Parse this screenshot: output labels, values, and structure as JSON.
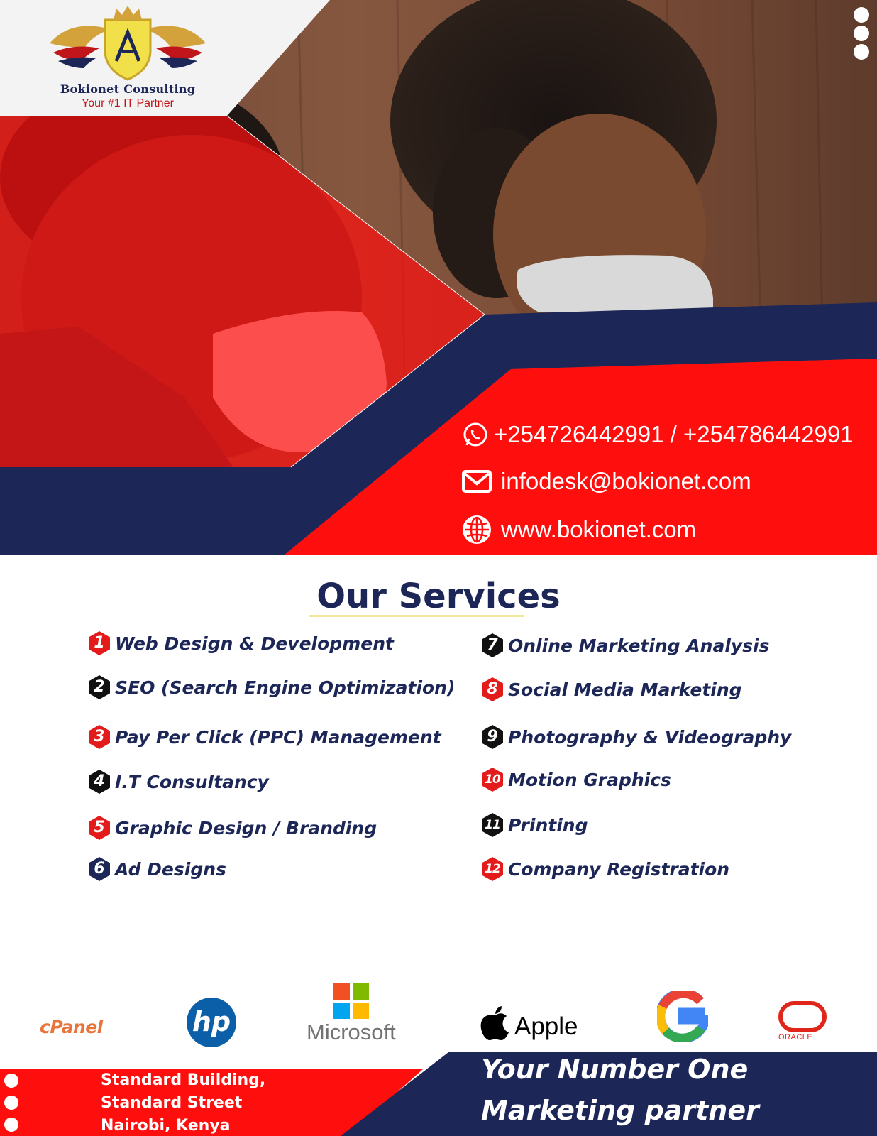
{
  "brand": {
    "name": "Bokionet Consulting",
    "tagline": "Your #1 IT Partner"
  },
  "contact": {
    "phones": "+254726442991 / +254786442991",
    "email": "infodesk@bokionet.com",
    "website": "www.bokionet.com"
  },
  "services": {
    "title": "Our Services",
    "items": [
      {
        "num": "1",
        "label": "Web Design & Development",
        "color": "#e31b1b"
      },
      {
        "num": "2",
        "label": "SEO (Search Engine Optimization)",
        "color": "#111111"
      },
      {
        "num": "3",
        "label": "Pay Per Click (PPC) Management",
        "color": "#e31b1b"
      },
      {
        "num": "4",
        "label": "I.T Consultancy",
        "color": "#111111"
      },
      {
        "num": "5",
        "label": "Graphic Design / Branding",
        "color": "#e31b1b"
      },
      {
        "num": "6",
        "label": "Ad Designs",
        "color": "#1c2657"
      },
      {
        "num": "7",
        "label": "Online Marketing Analysis",
        "color": "#111111"
      },
      {
        "num": "8",
        "label": "Social Media Marketing",
        "color": "#e31b1b"
      },
      {
        "num": "9",
        "label": "Photography & Videography",
        "color": "#111111"
      },
      {
        "num": "10",
        "label": "Motion Graphics",
        "color": "#e31b1b"
      },
      {
        "num": "11",
        "label": "Printing",
        "color": "#111111"
      },
      {
        "num": "12",
        "label": "Company Registration",
        "color": "#e31b1b"
      }
    ]
  },
  "partners": {
    "cpanel": "cPanel",
    "hp": "hp",
    "microsoft": "Microsoft",
    "apple": "Apple",
    "google": "G",
    "oracle": "ORACLE"
  },
  "footer": {
    "address_line1": "Standard Building,",
    "address_line2": "Standard Street",
    "address_line3": "Nairobi, Kenya",
    "slogan_line1": "Your Number One",
    "slogan_line2": "Marketing partner"
  },
  "colors": {
    "navy": "#1c2657",
    "red": "#ff0e0e",
    "accent_yellow": "#f2e79a"
  }
}
